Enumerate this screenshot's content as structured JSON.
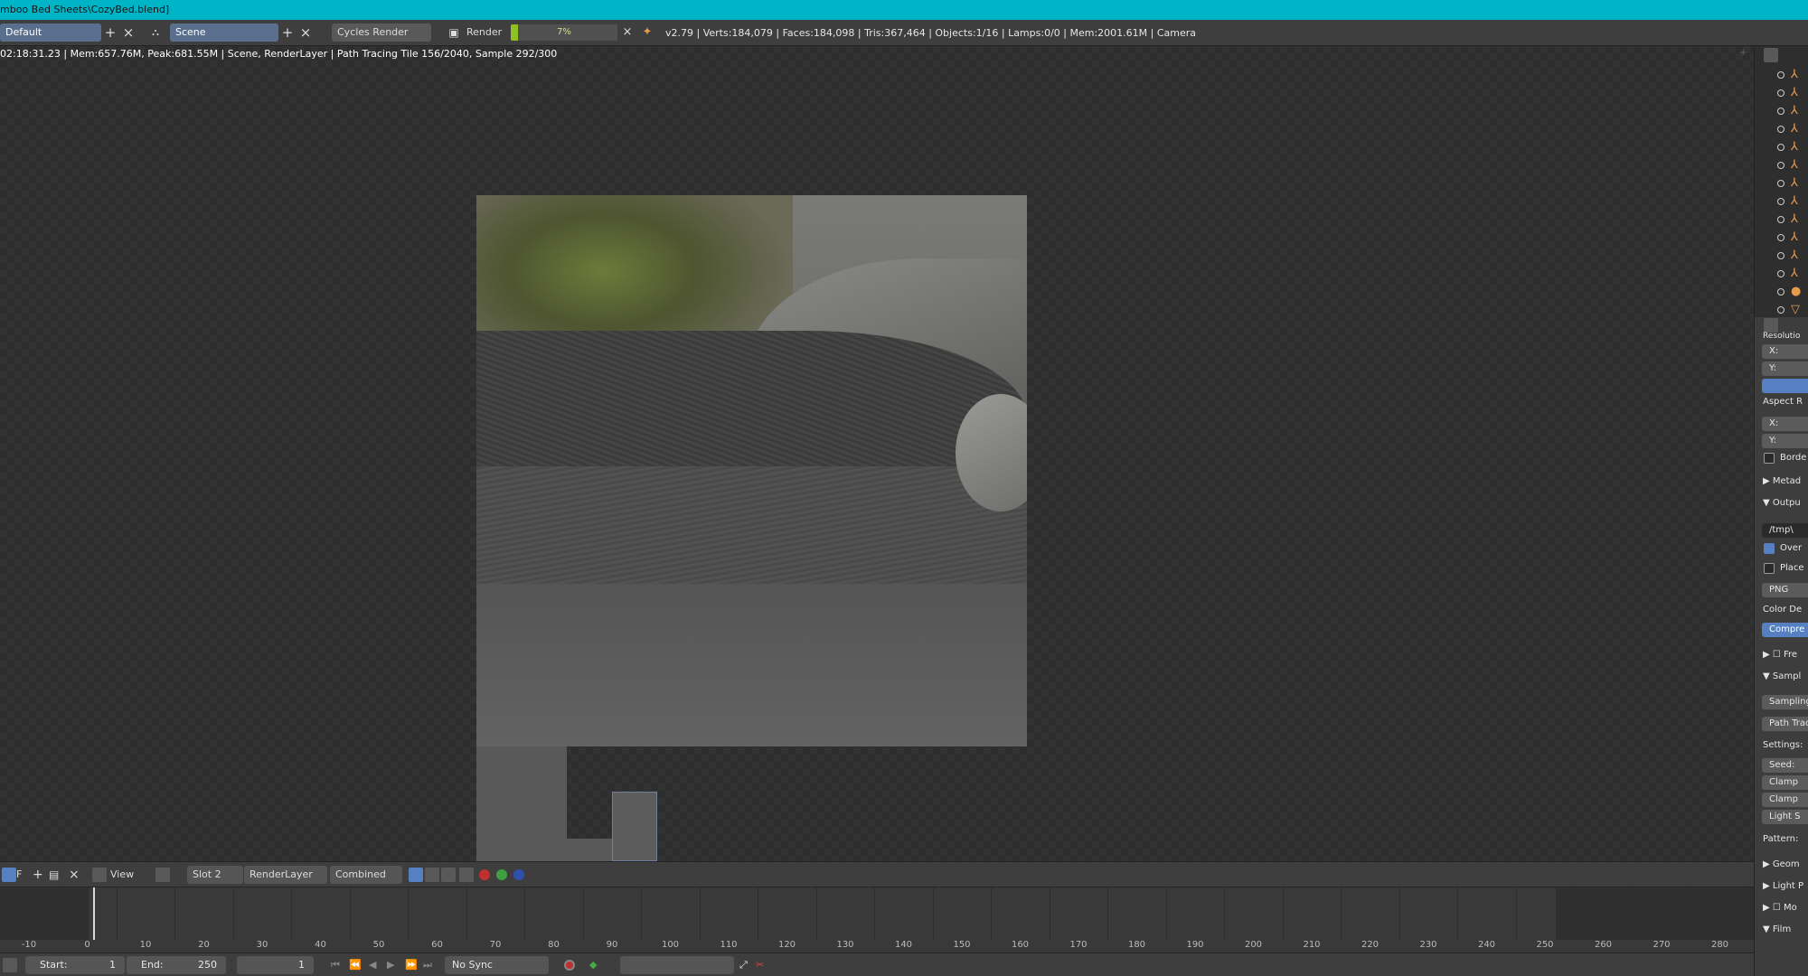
{
  "window": {
    "title": "mboo Bed Sheets\\CozyBed.blend]"
  },
  "infobar": {
    "layout": "Default",
    "scene": "Scene",
    "engine": "Cycles Render",
    "render_menu": "Render",
    "progress_percent": 7,
    "progress_label": "7%",
    "stats": "v2.79 | Verts:184,079 | Faces:184,098 | Tris:367,464 | Objects:1/16 | Lamps:0/0 | Mem:2001.61M | Camera"
  },
  "render_status": "02:18:31.23 | Mem:657.76M, Peak:681.55M | Scene, RenderLayer | Path Tracing Tile 156/2040, Sample 292/300",
  "image_header": {
    "view": "View",
    "slot": "Slot 2",
    "layer": "RenderLayer",
    "pass": "Combined",
    "f_label": "F"
  },
  "timeline": {
    "ticks": [
      "-10",
      "0",
      "10",
      "20",
      "30",
      "40",
      "50",
      "60",
      "70",
      "80",
      "90",
      "100",
      "110",
      "120",
      "130",
      "140",
      "150",
      "160",
      "170",
      "180",
      "190",
      "200",
      "210",
      "220",
      "230",
      "240",
      "250",
      "260",
      "270",
      "280"
    ],
    "current_frame": 1
  },
  "footer": {
    "start_label": "Start:",
    "start_value": "1",
    "end_label": "End:",
    "end_value": "250",
    "current": "1",
    "sync": "No Sync"
  },
  "outliner": {
    "icons": [
      "camera-empty",
      "camera-empty",
      "camera-empty",
      "camera-empty",
      "camera-empty",
      "camera-empty",
      "camera-empty",
      "camera-empty",
      "camera-empty",
      "camera-empty",
      "camera-empty",
      "camera-empty",
      "material",
      "mesh"
    ]
  },
  "properties": {
    "resolution": "Resolutio",
    "x": "X:",
    "y": "Y:",
    "aspect": "Aspect R",
    "ax": "X:",
    "ay": "Y:",
    "border": "Borde",
    "metadata": "Metad",
    "output": "Outpu",
    "path": "/tmp\\",
    "overwrite": "Over",
    "placeholders": "Place",
    "format": "PNG",
    "color_depth": "Color De",
    "compression": "Compre",
    "freestyle": "Fre",
    "sampling": "Sampl",
    "sampling_presets": "Sampling",
    "path_tracing": "Path Trac",
    "settings": "Settings:",
    "seed": "Seed:",
    "clamp1": "Clamp",
    "clamp2": "Clamp",
    "light_sampling": "Light S",
    "pattern": "Pattern:",
    "geometry": "Geom",
    "light_paths": "Light P",
    "motion": "Mo",
    "film": "Film"
  }
}
